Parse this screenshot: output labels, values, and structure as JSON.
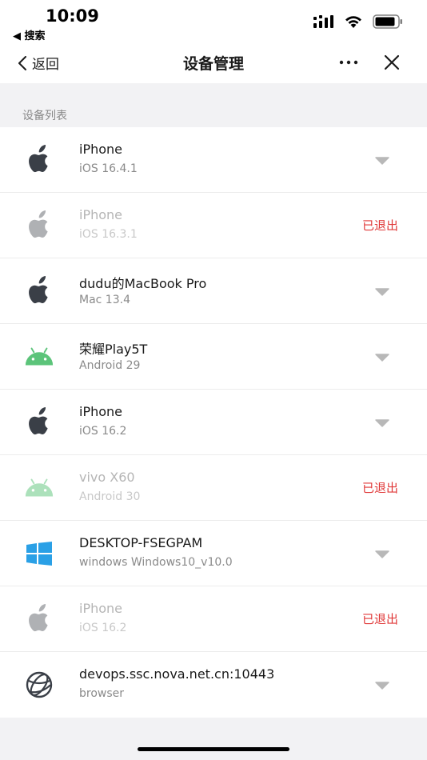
{
  "status_bar": {
    "time": "10:09",
    "back_app": "◀ 搜索"
  },
  "nav": {
    "back_label": "返回",
    "title": "设备管理"
  },
  "section": {
    "label": "设备列表"
  },
  "devices": [
    {
      "name": "iPhone",
      "os": "iOS 16.4.1",
      "icon": "apple-icon",
      "status": ""
    },
    {
      "name": "iPhone",
      "os": "iOS 16.3.1",
      "icon": "apple-icon",
      "status": "已退出"
    },
    {
      "name": "dudu的MacBook Pro",
      "os": "Mac 13.4",
      "icon": "apple-icon",
      "status": ""
    },
    {
      "name": "荣耀Play5T",
      "os": "Android 29",
      "icon": "android-icon",
      "status": ""
    },
    {
      "name": "iPhone",
      "os": "iOS 16.2",
      "icon": "apple-icon",
      "status": ""
    },
    {
      "name": "vivo X60",
      "os": "Android 30",
      "icon": "android-icon",
      "status": "已退出"
    },
    {
      "name": "DESKTOP-FSEGPAM",
      "os": "windows Windows10_v10.0",
      "icon": "windows-icon",
      "status": ""
    },
    {
      "name": "iPhone",
      "os": "iOS 16.2",
      "icon": "apple-icon",
      "status": "已退出"
    },
    {
      "name": "devops.ssc.nova.net.cn:10443",
      "os": "browser",
      "icon": "globe-icon",
      "status": ""
    }
  ],
  "colors": {
    "logged_out": "#e03a3a",
    "android": "#5cc47a",
    "windows": "#2aa0e6",
    "apple": "#3a3f47"
  }
}
